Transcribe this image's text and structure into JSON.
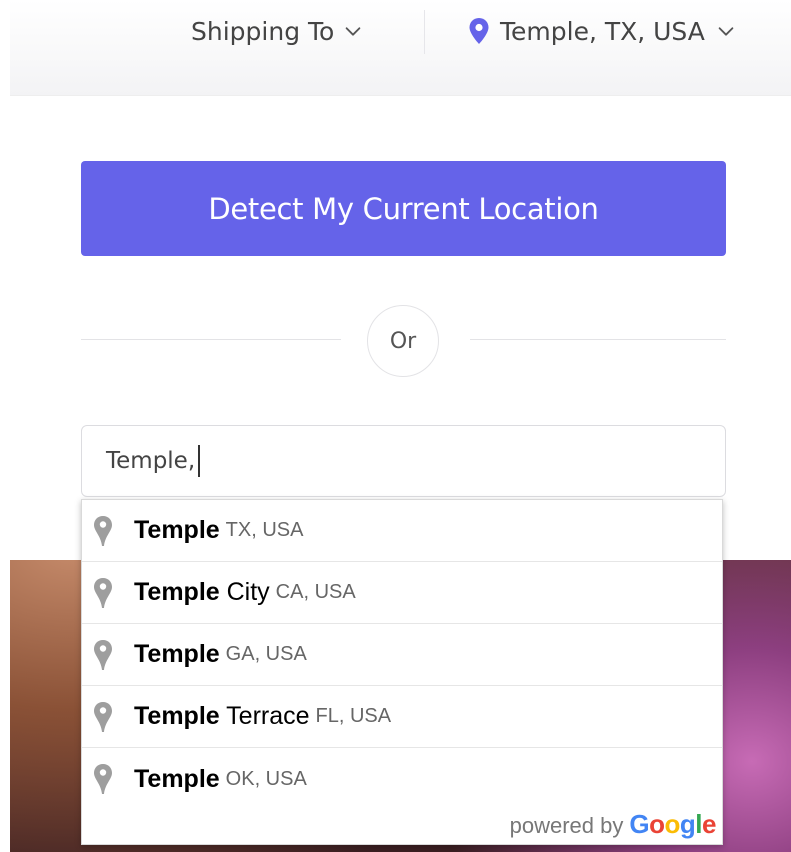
{
  "header": {
    "shipping_label": "Shipping To",
    "location_label": "Temple, TX, USA",
    "location_icon": "map-pin-icon",
    "chevron_icon": "chevron-down-icon",
    "accent_color": "#6563e9"
  },
  "panel": {
    "detect_button_label": "Detect My Current Location",
    "or_label": "Or",
    "search_value": "Temple,"
  },
  "suggestions": [
    {
      "match": "Temple",
      "rest": "",
      "secondary": "TX, USA"
    },
    {
      "match": "Temple",
      "rest": " City",
      "secondary": "CA, USA"
    },
    {
      "match": "Temple",
      "rest": "",
      "secondary": "GA, USA"
    },
    {
      "match": "Temple",
      "rest": " Terrace",
      "secondary": "FL, USA"
    },
    {
      "match": "Temple",
      "rest": "",
      "secondary": "OK, USA"
    }
  ],
  "attribution": {
    "powered_by": "powered by",
    "brand": "Google"
  }
}
